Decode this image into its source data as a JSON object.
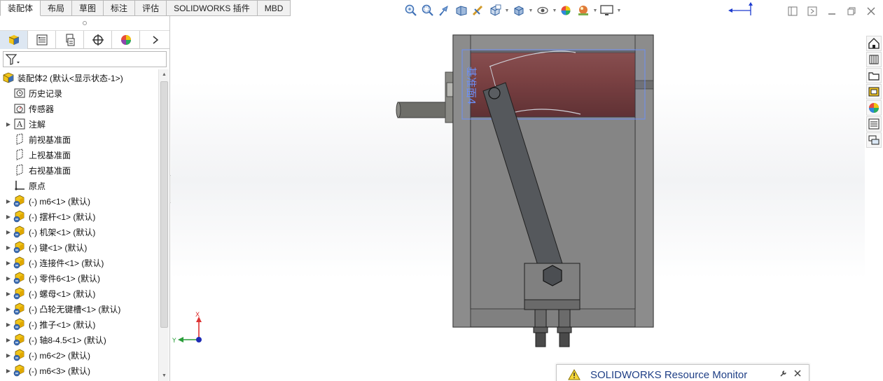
{
  "ribbon": {
    "tabs": [
      {
        "label": "装配体",
        "active": true
      },
      {
        "label": "布局",
        "active": false
      },
      {
        "label": "草图",
        "active": false
      },
      {
        "label": "标注",
        "active": false
      },
      {
        "label": "评估",
        "active": false
      },
      {
        "label": "SOLIDWORKS 插件",
        "active": false
      },
      {
        "label": "MBD",
        "active": false
      }
    ]
  },
  "heads_up_toolbar": {
    "icons": [
      "zoom-to-fit-icon",
      "zoom-to-area-icon",
      "previous-view-icon",
      "section-view-icon",
      "dynamic-annotation-icon",
      "view-orientation-icon",
      "display-style-icon",
      "hide-show-items-icon",
      "edit-appearance-icon",
      "apply-scene-icon",
      "view-settings-icon"
    ]
  },
  "feature_manager": {
    "tabs": [
      "feature-manager-tab",
      "property-manager-tab",
      "configuration-manager-tab",
      "dimxpert-manager-tab",
      "display-manager-tab"
    ],
    "filter_icon": "filter-icon",
    "tree": [
      {
        "label": "装配体2  (默认<显示状态-1>)",
        "icon": "assembly-icon",
        "indent": 0,
        "expander": "none"
      },
      {
        "label": "历史记录",
        "icon": "history-icon",
        "indent": 1,
        "expander": "none"
      },
      {
        "label": "传感器",
        "icon": "sensor-icon",
        "indent": 1,
        "expander": "none"
      },
      {
        "label": "注解",
        "icon": "annotation-icon",
        "indent": 1,
        "expander": "collapsed"
      },
      {
        "label": "前视基准面",
        "icon": "plane-icon",
        "indent": 1,
        "expander": "none"
      },
      {
        "label": "上视基准面",
        "icon": "plane-icon",
        "indent": 1,
        "expander": "none"
      },
      {
        "label": "右视基准面",
        "icon": "plane-icon",
        "indent": 1,
        "expander": "none"
      },
      {
        "label": "原点",
        "icon": "origin-icon",
        "indent": 1,
        "expander": "none"
      },
      {
        "label": "(-) m6<1> (默认)",
        "icon": "part-icon",
        "indent": 1,
        "expander": "collapsed"
      },
      {
        "label": "(-) 摆杆<1> (默认)",
        "icon": "part-icon",
        "indent": 1,
        "expander": "collapsed"
      },
      {
        "label": "(-) 机架<1> (默认)",
        "icon": "part-icon",
        "indent": 1,
        "expander": "collapsed"
      },
      {
        "label": "(-) 键<1> (默认)",
        "icon": "part-icon",
        "indent": 1,
        "expander": "collapsed"
      },
      {
        "label": "(-) 连接件<1> (默认)",
        "icon": "part-icon",
        "indent": 1,
        "expander": "collapsed"
      },
      {
        "label": "(-) 零件6<1> (默认)",
        "icon": "part-icon",
        "indent": 1,
        "expander": "collapsed"
      },
      {
        "label": "(-) 螺母<1> (默认)",
        "icon": "part-icon",
        "indent": 1,
        "expander": "collapsed"
      },
      {
        "label": "(-) 凸轮无键槽<1> (默认)",
        "icon": "part-icon",
        "indent": 1,
        "expander": "collapsed"
      },
      {
        "label": "(-) 推子<1> (默认)",
        "icon": "part-icon",
        "indent": 1,
        "expander": "collapsed"
      },
      {
        "label": "(-) 轴8-4.5<1> (默认)",
        "icon": "part-icon",
        "indent": 1,
        "expander": "collapsed"
      },
      {
        "label": "(-) m6<2> (默认)",
        "icon": "part-icon",
        "indent": 1,
        "expander": "collapsed"
      },
      {
        "label": "(-) m6<3> (默认)",
        "icon": "part-icon",
        "indent": 1,
        "expander": "collapsed"
      }
    ]
  },
  "viewport": {
    "plane_label": "基准面4",
    "triad": {
      "x_label": "X",
      "y_label": "Y"
    },
    "colors": {
      "frame": "#8c8c8c",
      "cam": "#7f3c36",
      "link": "#55585c",
      "plane": "#6d8ff5"
    }
  },
  "task_pane": {
    "icons": [
      "solidworks-resources-icon",
      "design-library-icon",
      "file-explorer-icon",
      "view-palette-icon",
      "appearances-icon",
      "custom-properties-icon",
      "forum-icon"
    ]
  },
  "notification": {
    "text": "SOLIDWORKS Resource Monitor",
    "icon": "warning-icon"
  }
}
